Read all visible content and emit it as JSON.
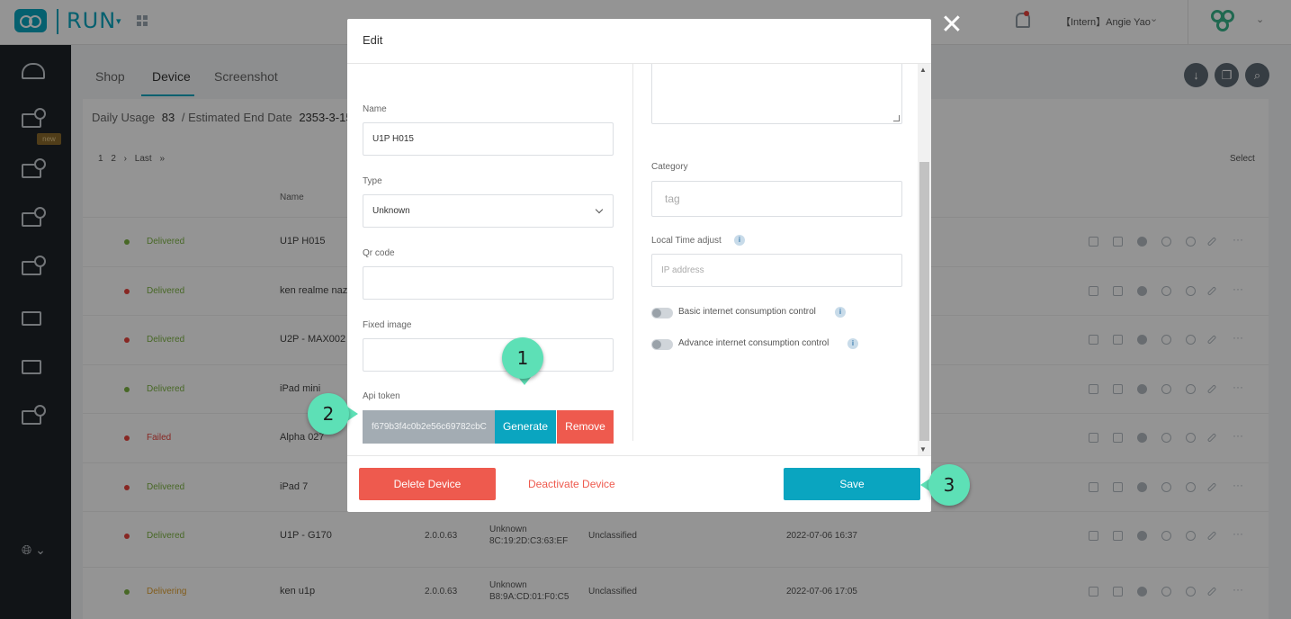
{
  "header": {
    "app_name": "RUN",
    "user": "【Intern】Angie Yao"
  },
  "tabs": [
    {
      "label": "Shop"
    },
    {
      "label": "Device"
    },
    {
      "label": "Screenshot"
    }
  ],
  "sidebar": {
    "new_badge": "new",
    "language_icon": "globe-icon"
  },
  "summary": {
    "daily_usage_label": "Daily Usage",
    "daily_usage_value": "83",
    "separator": "/",
    "end_date_label": "Estimated End Date",
    "end_date_value": "2353-3-15"
  },
  "pager": {
    "pages": "1 2 › Last »",
    "select_label": "Select"
  },
  "table": {
    "name_header": "Name",
    "rows": [
      {
        "status": "Delivered",
        "status_color": "#7cb342",
        "dot_color": "#7cb342",
        "name": "U1P H015",
        "version": "",
        "mac1": "",
        "mac2": "",
        "category": "",
        "date": ""
      },
      {
        "status": "Delivered",
        "status_color": "#7cb342",
        "dot_color": "#e9443d",
        "name": "ken realme naz",
        "version": "",
        "mac1": "",
        "mac2": "",
        "category": "",
        "date": ""
      },
      {
        "status": "Delivered",
        "status_color": "#7cb342",
        "dot_color": "#e9443d",
        "name": "U2P - MAX002",
        "version": "",
        "mac1": "",
        "mac2": "",
        "category": "",
        "date": ""
      },
      {
        "status": "Delivered",
        "status_color": "#7cb342",
        "dot_color": "#7cb342",
        "name": "iPad mini",
        "version": "",
        "mac1": "",
        "mac2": "",
        "category": "",
        "date": ""
      },
      {
        "status": "Failed",
        "status_color": "#e9443d",
        "dot_color": "#e9443d",
        "name": "Alpha 027",
        "version": "",
        "mac1": "",
        "mac2": "",
        "category": "",
        "date": ""
      },
      {
        "status": "Delivered",
        "status_color": "#7cb342",
        "dot_color": "#e9443d",
        "name": "iPad 7",
        "version": "",
        "mac1": "",
        "mac2": "",
        "category": "",
        "date": ""
      },
      {
        "status": "Delivered",
        "status_color": "#7cb342",
        "dot_color": "#e9443d",
        "name": "U1P - G170",
        "version": "2.0.0.63",
        "mac1": "Unknown",
        "mac2": "8C:19:2D:C3:63:EF",
        "category": "Unclassified",
        "date": "2022-07-06 16:37"
      },
      {
        "status": "Delivering",
        "status_color": "#e0a030",
        "dot_color": "#7cb342",
        "name": "ken u1p",
        "version": "2.0.0.63",
        "mac1": "Unknown",
        "mac2": "B8:9A:CD:01:F0:C5",
        "category": "Unclassified",
        "date": "2022-07-06 17:05"
      }
    ]
  },
  "modal": {
    "title": "Edit",
    "name_label": "Name",
    "name_value": "U1P H015",
    "type_label": "Type",
    "type_value": "Unknown",
    "qr_label": "Qr code",
    "qr_value": "",
    "fixed_image_label": "Fixed image",
    "fixed_image_value": "",
    "api_token_label": "Api token",
    "api_token_value": "f679b3f4c0b2e56c69782cbC",
    "generate_label": "Generate",
    "remove_label": "Remove",
    "category_label": "Category",
    "category_placeholder": "tag",
    "local_time_label": "Local Time adjust",
    "local_time_placeholder": "IP address",
    "basic_internet_label": "Basic internet consumption control",
    "advance_internet_label": "Advance internet consumption control",
    "delete_label": "Delete Device",
    "deactivate_label": "Deactivate Device",
    "save_label": "Save",
    "info_glyph": "i"
  },
  "callouts": {
    "one": "1",
    "two": "2",
    "three": "3"
  },
  "colors": {
    "accent": "#0aa5c0",
    "danger": "#ee5a4e",
    "callout": "#5de0b6"
  }
}
